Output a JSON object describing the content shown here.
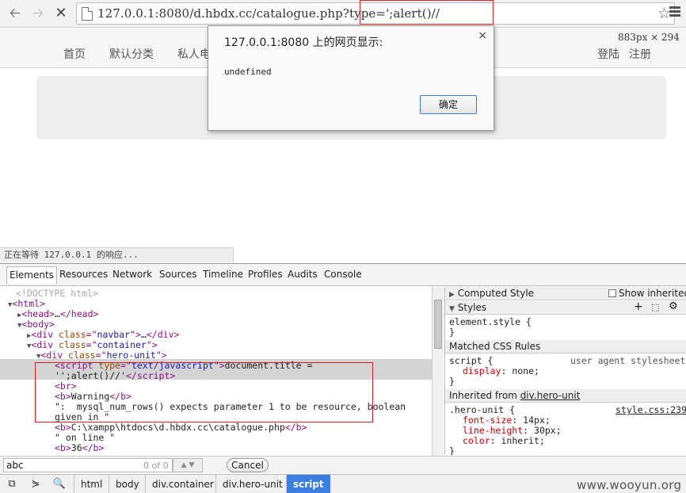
{
  "browser": {
    "url": "127.0.0.1:8080/d.hbdx.cc/catalogue.php?type=';alert()//",
    "status": "正在等待 127.0.0.1 的响应..."
  },
  "page": {
    "nav": [
      "首页",
      "默认分类",
      "私人电"
    ],
    "login": "登陆",
    "register": "注册",
    "dims": "883px × 294"
  },
  "alert": {
    "title": "127.0.0.1:8080 上的网页显示:",
    "message": "undefined",
    "ok": "确定",
    "close": "×"
  },
  "devtools": {
    "tabs": [
      "Elements",
      "Resources",
      "Network",
      "Sources",
      "Timeline",
      "Profiles",
      "Audits",
      "Console"
    ],
    "dom": {
      "doctype": "<!DOCTYPE html>",
      "html": "html",
      "head": "head",
      "body": "body",
      "navbar_class": "navbar",
      "container_class": "container",
      "hero_class": "hero-unit",
      "script_type": "text/javascript",
      "script_text_1": "document.title =",
      "script_text_2": "'';alert()//'",
      "warning": "Warning",
      "error_1": "\":  mysql_num_rows() expects parameter 1 to be resource, boolean",
      "error_2": "given in \"",
      "path": "C:\\xampp\\htdocs\\d.hbdx.cc\\catalogue.php",
      "on_line": "\" on line \"",
      "line_no": "36"
    },
    "sidebar": {
      "computed_style": "Computed Style",
      "show_inherited": "Show inherited",
      "styles": "Styles",
      "element_style": "element.style {",
      "close_brace": "}",
      "matched_rules": "Matched CSS Rules",
      "script_rule": "script {",
      "user_agent": "user agent stylesheet",
      "display_prop": "display",
      "display_val": "none;",
      "inherited_from": "Inherited from",
      "inherited_el": "div.hero-unit",
      "hero_rule": ".hero-unit {",
      "hero_source": "style.css:239",
      "font_size_prop": "font-size",
      "font_size_val": "14px;",
      "line_height_prop": "line-height",
      "line_height_val": "30px;",
      "color_prop": "color",
      "color_val": "inherit;"
    },
    "search": {
      "value": "abc",
      "count": "0 of 0",
      "cancel": "Cancel"
    },
    "breadcrumbs": [
      "html",
      "body",
      "div.container",
      "div.hero-unit",
      "script"
    ]
  },
  "watermark": "www.wooyun.org"
}
